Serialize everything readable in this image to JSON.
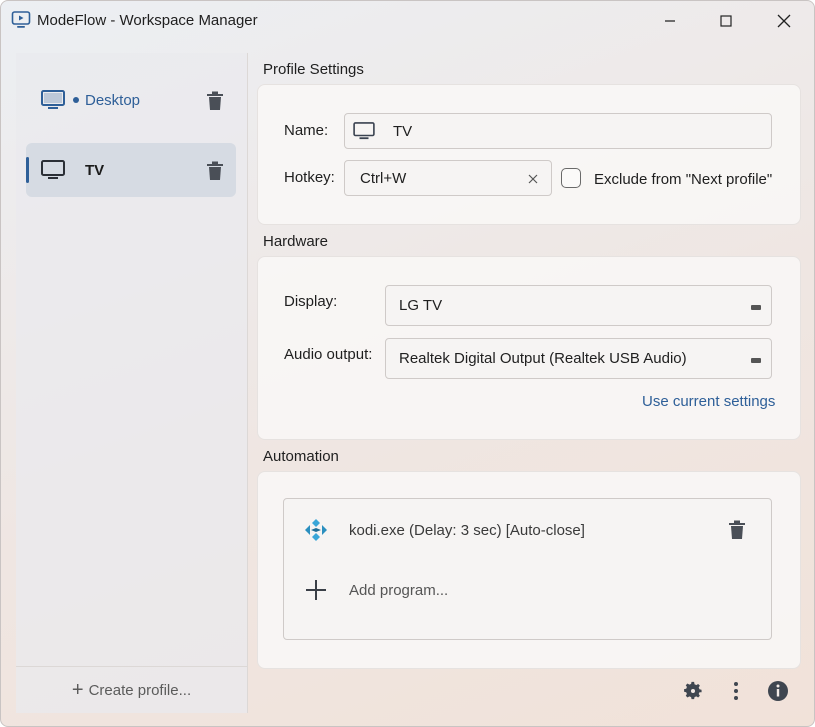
{
  "window": {
    "title": "ModeFlow - Workspace Manager",
    "accent_color": "#2e5f98"
  },
  "sidebar": {
    "items": [
      {
        "label": "Desktop",
        "icon": "monitor-icon",
        "active_indicator": true,
        "selected": false
      },
      {
        "label": "TV",
        "icon": "monitor-icon",
        "active_indicator": false,
        "selected": true
      }
    ],
    "create_label": "Create profile..."
  },
  "profile_settings": {
    "title": "Profile Settings",
    "name_label": "Name:",
    "name_value": "TV",
    "hotkey_label": "Hotkey:",
    "hotkey_value": "Ctrl+W",
    "exclude_label": "Exclude from \"Next profile\"",
    "exclude_checked": false
  },
  "hardware": {
    "title": "Hardware",
    "display_label": "Display:",
    "display_value": "LG TV",
    "audio_label": "Audio output:",
    "audio_value": "Realtek Digital Output (Realtek USB Audio)",
    "use_current_label": "Use current settings"
  },
  "automation": {
    "title": "Automation",
    "programs": [
      {
        "label": "kodi.exe (Delay: 3 sec) [Auto-close]",
        "icon": "kodi-icon"
      }
    ],
    "add_label": "Add program..."
  },
  "bottom_toolbar": {
    "icons": [
      "gear-icon",
      "more-vertical-icon",
      "info-icon"
    ]
  }
}
